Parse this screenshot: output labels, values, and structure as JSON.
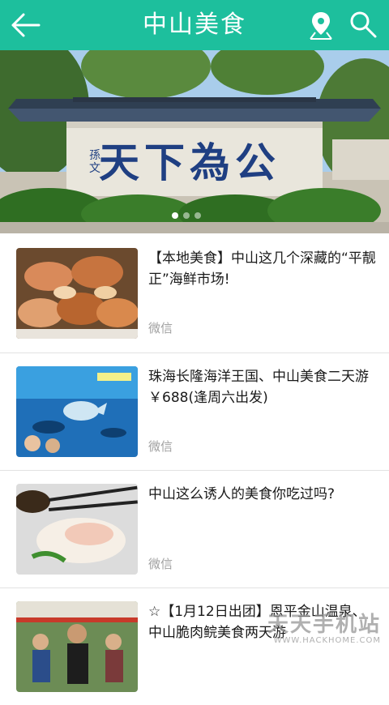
{
  "header": {
    "title": "中山美食",
    "back_icon": "arrow-left-icon",
    "location_icon": "map-pin-icon",
    "search_icon": "search-icon",
    "bg_color": "#1dbf9d"
  },
  "banner": {
    "caption": "天下為公",
    "signature": "孫文"
  },
  "articles": [
    {
      "title": "【本地美食】中山这几个深藏的“平靓正”海鲜市场!",
      "source": "微信"
    },
    {
      "title": "珠海长隆海洋王国、中山美食二天游￥688(逢周六出发)",
      "source": "微信"
    },
    {
      "title": "中山这么诱人的美食你吃过吗?",
      "source": "微信"
    },
    {
      "title": "☆【1月12日出团】恩平金山温泉、中山脆肉鲩美食两天游",
      "source": ""
    }
  ],
  "watermark": {
    "line1": "天天手机站",
    "line2": "WWW.HACKHOME.COM"
  }
}
